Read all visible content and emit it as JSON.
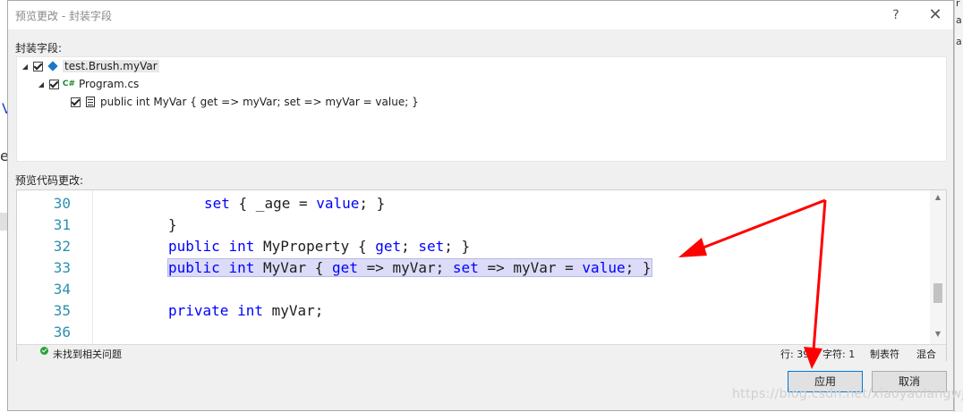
{
  "window": {
    "title": "预览更改 - 封装字段",
    "help_label": "?",
    "close_label": "✕"
  },
  "fields_section": {
    "label": "封装字段:",
    "tree": [
      {
        "level": 0,
        "expanded": true,
        "checked": true,
        "icon": "class-icon",
        "label": "test.Brush.myVar"
      },
      {
        "level": 1,
        "expanded": true,
        "checked": true,
        "icon": "csharp-file-icon",
        "icon_text": "C#",
        "label": "Program.cs"
      },
      {
        "level": 2,
        "expanded": false,
        "checked": true,
        "icon": "property-icon",
        "label": "public int MyVar { get => myVar; set => myVar = value; }"
      }
    ]
  },
  "preview_section": {
    "label": "预览代码更改:",
    "lines": [
      {
        "num": "30"
      },
      {
        "num": "31"
      },
      {
        "num": "32"
      },
      {
        "num": "33"
      },
      {
        "num": "34"
      },
      {
        "num": "35"
      },
      {
        "num": "36"
      }
    ],
    "code": {
      "l30_kw": "set",
      "l30_rest": " { _age = ",
      "l30_kw2": "value",
      "l30_end": "; }",
      "l31": "}",
      "l32_kw1": "public",
      "l32_kw2": "int",
      "l32_name": " MyProperty { ",
      "l32_kw3": "get",
      "l32_mid": "; ",
      "l32_kw4": "set",
      "l32_end": "; }",
      "l33_kw1": "public",
      "l33_kw2": "int",
      "l33_name": " MyVar { ",
      "l33_kw3": "get",
      "l33_mid": " => myVar; ",
      "l33_kw4": "set",
      "l33_mid2": " => myVar = ",
      "l33_kw5": "value",
      "l33_end": "; }",
      "l35_kw1": "private",
      "l35_kw2": "int",
      "l35_rest": " myVar;"
    },
    "status": {
      "issues": "未找到相关问题",
      "line": "行: 39",
      "char": "字符: 1",
      "tabs": "制表符",
      "eol": "混合"
    }
  },
  "buttons": {
    "apply": "应用",
    "cancel": "取消"
  },
  "watermark": "https://blog.csdn.net/xiaoyaolangwj",
  "colors": {
    "keyword": "#0000ff",
    "line_number": "#2b91af",
    "highlight": "#dcdcf8",
    "annotation_arrow": "#ff0000"
  }
}
